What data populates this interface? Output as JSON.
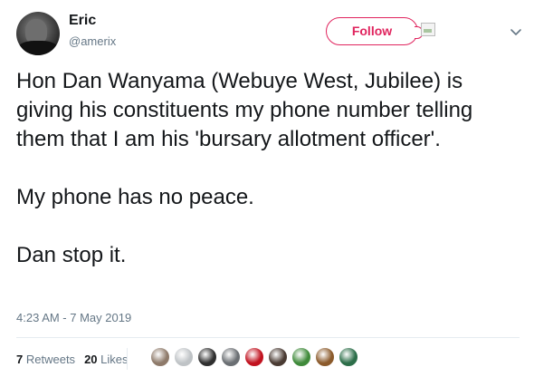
{
  "user": {
    "display_name": "Eric",
    "screen_name": "@amerix",
    "avatar_icon": "profile-photo"
  },
  "actions": {
    "follow_label": "Follow",
    "follow_color": "#e0245e"
  },
  "tweet": {
    "paragraphs": [
      "Hon Dan Wanyama (Webuye West, Jubilee) is giving his constituents my phone number telling them that I am his 'bursary allotment officer'.",
      "My phone has no peace.",
      "Dan stop it."
    ],
    "timestamp": "4:23 AM - 7 May 2019"
  },
  "stats": {
    "retweets_count": "7",
    "retweets_label": "Retweets",
    "likes_count": "20",
    "likes_label": "Likes"
  },
  "likers": [
    {
      "name": "liker-avatar-1",
      "color": "#8e7a6a"
    },
    {
      "name": "liker-avatar-2",
      "color": "#bfc3c6"
    },
    {
      "name": "liker-avatar-3",
      "color": "#2f2f2f"
    },
    {
      "name": "liker-avatar-4",
      "color": "#6b6f73"
    },
    {
      "name": "liker-avatar-5",
      "color": "#c1121f"
    },
    {
      "name": "liker-avatar-6",
      "color": "#4a3b33"
    },
    {
      "name": "liker-avatar-7",
      "color": "#3f8a3a"
    },
    {
      "name": "liker-avatar-8",
      "color": "#8b5a2b"
    },
    {
      "name": "liker-avatar-9",
      "color": "#2c6e49"
    }
  ]
}
